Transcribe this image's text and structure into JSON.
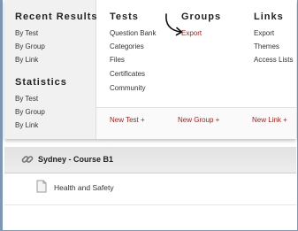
{
  "menu": {
    "recent_results": {
      "heading": "Recent Results",
      "items": [
        "By Test",
        "By Group",
        "By Link"
      ]
    },
    "statistics": {
      "heading": "Statistics",
      "items": [
        "By Test",
        "By Group",
        "By Link"
      ]
    },
    "tests": {
      "heading": "Tests",
      "items": [
        "Question Bank",
        "Categories",
        "Files",
        "Certificates",
        "Community"
      ],
      "new_label": "New Test +"
    },
    "groups": {
      "heading": "Groups",
      "items": [
        "Export"
      ],
      "new_label": "New Group +"
    },
    "links": {
      "heading": "Links",
      "items": [
        "Export",
        "Themes",
        "Access Lists"
      ],
      "new_label": "New Link +"
    }
  },
  "course": {
    "title": "Sydney - Course B1"
  },
  "content": {
    "item_label": "Health and Safety"
  },
  "colors": {
    "accent": "#a4231d",
    "frame": "#7f97b0",
    "left_panel": "#f1f1f1"
  },
  "icons": {
    "arrow": "curved-arrow-icon",
    "link": "link-chain-icon",
    "document": "document-icon"
  }
}
